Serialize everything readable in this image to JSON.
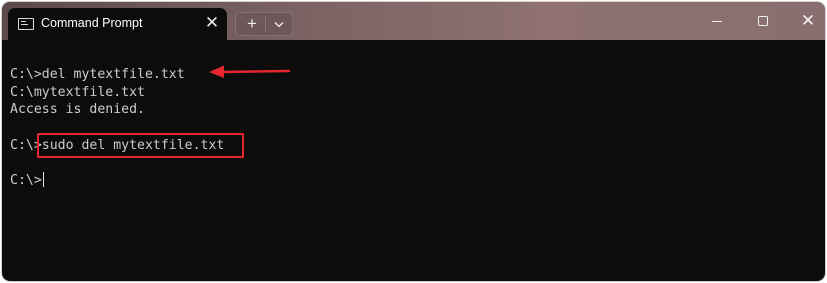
{
  "window": {
    "tab_title": "Command Prompt",
    "tab_icon": "terminal-icon",
    "close_tab_glyph": "✕",
    "new_tab_glyph": "+",
    "dropdown_glyph": "⌄",
    "close_window_glyph": "✕"
  },
  "console": {
    "lines": [
      "C:\\>del mytextfile.txt",
      "C:\\mytextfile.txt",
      "Access is denied.",
      "C:\\>sudo del mytextfile.txt",
      "C:\\>"
    ]
  },
  "annotations": {
    "arrow_color": "#e3262f",
    "box_color": "#e3262f"
  }
}
